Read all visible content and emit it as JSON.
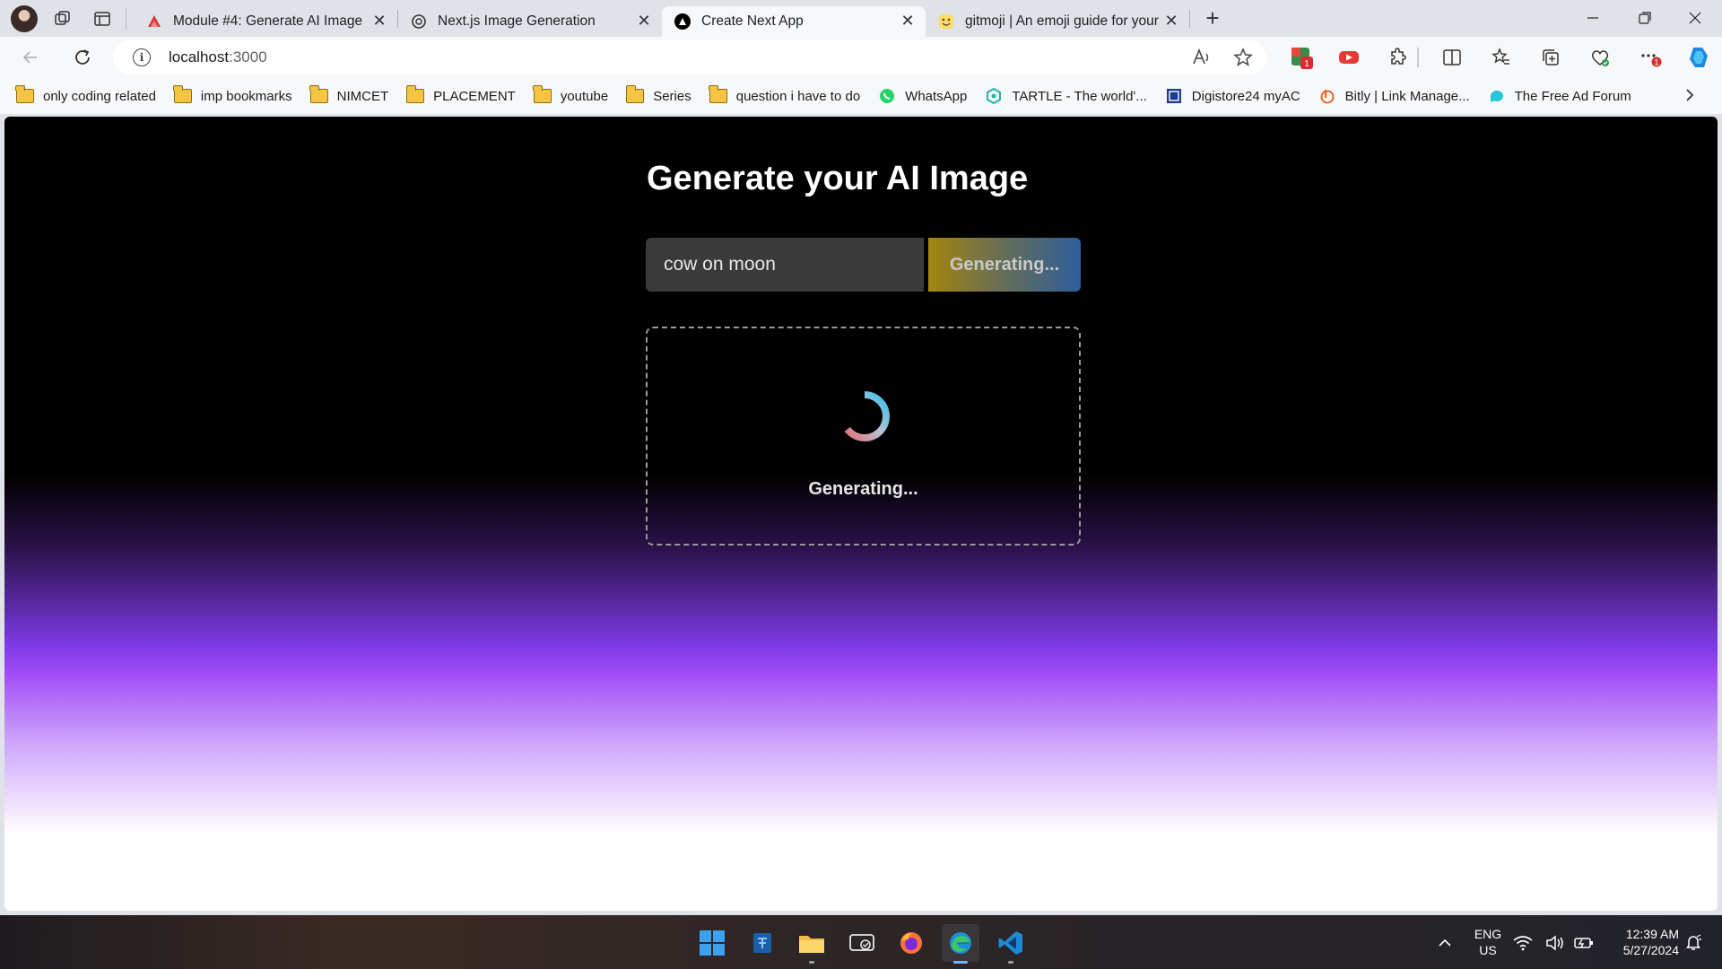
{
  "browser": {
    "tabs": [
      {
        "title": "Module #4: Generate AI Image",
        "active": false
      },
      {
        "title": "Next.js Image Generation",
        "active": false
      },
      {
        "title": "Create Next App",
        "active": true
      },
      {
        "title": "gitmoji | An emoji guide for your",
        "active": false
      }
    ],
    "address": {
      "host": "localhost",
      "port": ":3000"
    },
    "bookmarks": [
      {
        "label": "only coding  related",
        "icon": "folder-icon"
      },
      {
        "label": "imp bookmarks",
        "icon": "folder-icon"
      },
      {
        "label": "NIMCET",
        "icon": "folder-icon"
      },
      {
        "label": "PLACEMENT",
        "icon": "folder-icon"
      },
      {
        "label": "youtube",
        "icon": "folder-icon"
      },
      {
        "label": "Series",
        "icon": "folder-icon"
      },
      {
        "label": "question i have to do",
        "icon": "folder-icon"
      },
      {
        "label": "WhatsApp",
        "icon": "whatsapp-icon"
      },
      {
        "label": "TARTLE - The world'...",
        "icon": "tartle-icon"
      },
      {
        "label": "Digistore24 myAC",
        "icon": "digistore-icon"
      },
      {
        "label": "Bitly | Link Manage...",
        "icon": "bitly-icon"
      },
      {
        "label": "The Free Ad Forum",
        "icon": "adforum-icon"
      }
    ],
    "extension_badges": {
      "ext1": "1",
      "menu": "1"
    }
  },
  "page": {
    "heading": "Generate your AI Image",
    "prompt_value": "cow on moon",
    "button_label": "Generating...",
    "status": "Generating..."
  },
  "taskbar": {
    "lang_line1": "ENG",
    "lang_line2": "US",
    "time": "12:39 AM",
    "date": "5/27/2024"
  },
  "colors": {
    "accent_blue": "#6fb4ff",
    "button_gold": "#a3860e",
    "button_blue": "#2d5e9c",
    "purple": "#a04cf6"
  }
}
